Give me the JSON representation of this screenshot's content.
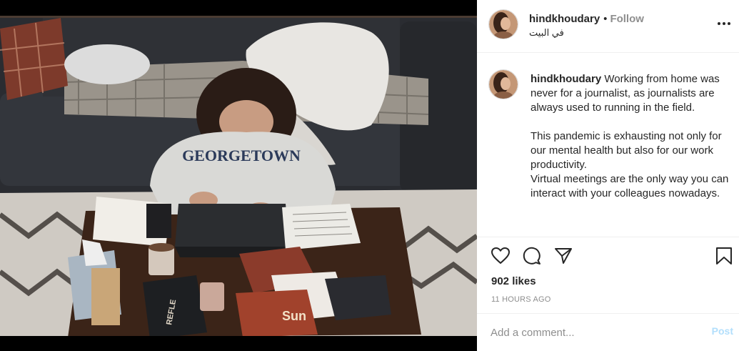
{
  "post": {
    "photo_label": "Woman in a Georgetown hoodie working on a laptop at a low table on a rug, couch behind her",
    "sweatshirt_text": "GEORGETOWN",
    "book_text": "REFLE",
    "chips_text": "Sun",
    "icons": {
      "avatar": "profile-avatar-icon",
      "more": "more-options-icon",
      "like": "heart-icon",
      "comment": "comment-icon",
      "share": "share-icon",
      "save": "bookmark-icon"
    }
  },
  "header": {
    "username": "hindkhoudary",
    "separator": "•",
    "follow_label": "Follow",
    "location": "في البيت"
  },
  "caption": {
    "username": "hindkhoudary",
    "paragraph1": "Working from home was never for a journalist, as journalists are always used to running in the field.",
    "paragraph2": "This pandemic is exhausting not only for our mental health but also for our work productivity.",
    "paragraph3": "Virtual meetings are the only way you can interact with your colleagues nowadays."
  },
  "stats": {
    "likes": "902 likes",
    "timestamp": "11 HOURS AGO"
  },
  "comment": {
    "placeholder": "Add a comment...",
    "post_label": "Post"
  },
  "colors": {
    "follow": "#8e8e8e",
    "post_disabled": "#b2dffc",
    "text": "#262626",
    "muted": "#8e8e8e"
  }
}
